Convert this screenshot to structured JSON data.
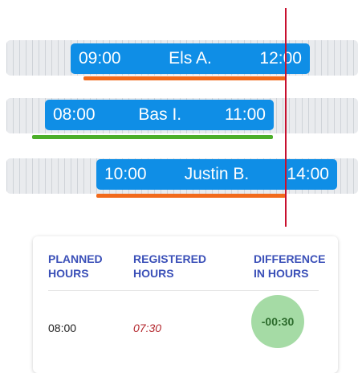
{
  "rows": [
    {
      "start": "09:00",
      "name": "Els A.",
      "end": "12:00",
      "underline_color": "#f26a1b"
    },
    {
      "start": "08:00",
      "name": "Bas I.",
      "end": "11:00",
      "underline_color": "#4caf2a"
    },
    {
      "start": "10:00",
      "name": "Justin B.",
      "end": "14:00",
      "underline_color": "#f26a1b"
    }
  ],
  "summary": {
    "headers": {
      "planned": [
        "PLANNED",
        "HOURS"
      ],
      "registered": [
        "REGISTERED",
        "HOURS"
      ],
      "difference": [
        "DIFFERENCE",
        "IN HOURS"
      ]
    },
    "planned_value": "08:00",
    "registered_value": "07:30",
    "difference_value": "-00:30"
  },
  "colors": {
    "shift_bar": "#0f8ee6",
    "header_text": "#3b50b8",
    "registered_text": "#b3262c",
    "difference_badge": "#a5dba5",
    "current_time_line": "#c8102e"
  }
}
